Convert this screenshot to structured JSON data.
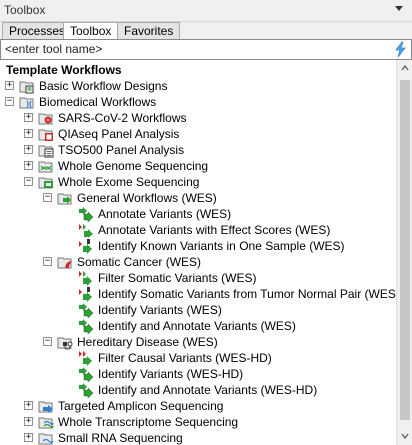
{
  "window": {
    "title": "Toolbox"
  },
  "tabs": [
    "Processes",
    "Toolbox",
    "Favorites"
  ],
  "search": {
    "placeholder": "<enter tool name>"
  },
  "tree": {
    "root": "Template Workflows",
    "basic": "Basic Workflow Designs",
    "biomedical": "Biomedical Workflows",
    "sarscov2": "SARS-CoV-2 Workflows",
    "qiaseq": "QIAseq Panel Analysis",
    "tso500": "TSO500 Panel Analysis",
    "wgs": "Whole Genome Sequencing",
    "wes": "Whole Exome Sequencing",
    "general": "General Workflows (WES)",
    "annotate": "Annotate Variants (WES)",
    "annotate_effect": "Annotate Variants with Effect Scores (WES)",
    "identify_known": "Identify Known Variants in One Sample (WES)",
    "somatic": "Somatic Cancer (WES)",
    "filter_somatic": "Filter Somatic Variants (WES)",
    "identify_somatic_pair": "Identify Somatic Variants from Tumor Normal Pair (WES)",
    "identify_variants": "Identify Variants (WES)",
    "identify_annotate": "Identify and Annotate Variants (WES)",
    "hereditary": "Hereditary Disease (WES)",
    "filter_causal": "Filter Causal Variants (WES-HD)",
    "identify_variants_hd": "Identify Variants (WES-HD)",
    "identify_annotate_hd": "Identify and Annotate Variants (WES-HD)",
    "targeted": "Targeted Amplicon Sequencing",
    "wts": "Whole Transcriptome Sequencing",
    "small_rna": "Small RNA Sequencing"
  },
  "colors": {
    "accent": "#2f7fd0",
    "workflow_green": "#2e9e3a",
    "workflow_red": "#cc2a2a"
  }
}
